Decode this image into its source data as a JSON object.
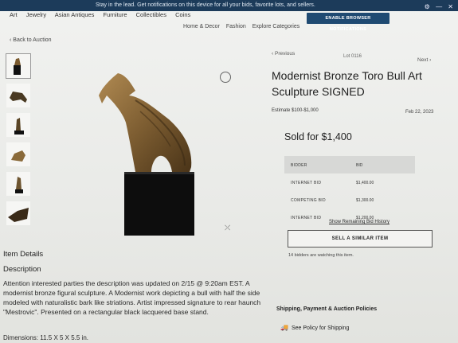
{
  "notification": {
    "message": "Stay in the lead. Get notifications on this device for all your bids, favorite lots, and sellers.",
    "button_label": "ENABLE BROWSER NOTIFICATIONS"
  },
  "categories": [
    "Art",
    "Jewelry",
    "Asian Antiques",
    "Furniture",
    "Collectibles",
    "Coins",
    "Home & Decor",
    "Fashion",
    "Explore Categories"
  ],
  "nav": {
    "back_label": "Back to Auction"
  },
  "lot_nav": {
    "previous": "Previous",
    "lot": "Lot 0116",
    "next": "Next"
  },
  "item": {
    "title": "Modernist Bronze Toro Bull Art Sculpture SIGNED",
    "estimate": "Estimate $100-$1,000",
    "date": "Feb 22, 2023",
    "sold": "Sold for $1,400"
  },
  "bids": {
    "headers": [
      "BIDDER",
      "BID"
    ],
    "rows": [
      {
        "bidder": "INTERNET BID",
        "bid": "$1,400.00"
      },
      {
        "bidder": "COMPETING BID",
        "bid": "$1,300.00"
      },
      {
        "bidder": "INTERNET BID",
        "bid": "$1,200.00"
      }
    ],
    "show_remaining": "Show Remaining Bid History"
  },
  "actions": {
    "sell_similar": "SELL A SIMILAR ITEM",
    "watching": "14 bidders are watching this item."
  },
  "details": {
    "section_title": "Item Details",
    "description_title": "Description",
    "description": "Attention interested parties the description was updated on 2/15 @ 9:20am EST. A modernist bronze figural sculpture. A Modernist work depicting a bull with half the side modeled with naturalistic bark like striations. Artist impressed signature to rear haunch \"Mestrovic\". Presented on a rectangular black lacquered base stand.",
    "dimensions": "Dimensions: 11.5 X 5 X 5.5 in."
  },
  "shipping": {
    "title": "Shipping, Payment & Auction Policies",
    "policy_link": "See Policy for Shipping"
  },
  "icons": {
    "favorite": "heart-icon",
    "share": "share-icon",
    "shipping": "truck-icon"
  }
}
